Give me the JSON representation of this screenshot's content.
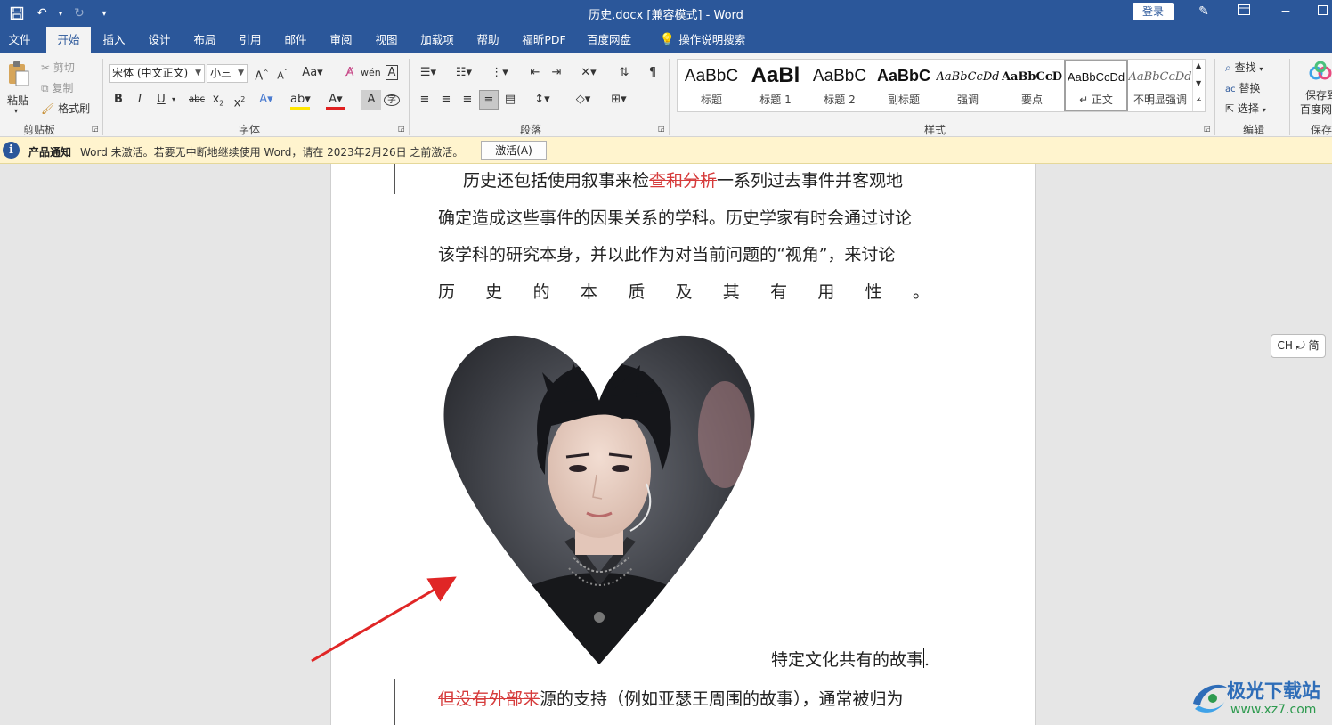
{
  "titlebar": {
    "title": "历史.docx [兼容模式]  -  Word",
    "login": "登录"
  },
  "menu": {
    "tabs": [
      "文件",
      "开始",
      "插入",
      "设计",
      "布局",
      "引用",
      "邮件",
      "审阅",
      "视图",
      "加载项",
      "帮助",
      "福昕PDF",
      "百度网盘"
    ],
    "active": "开始",
    "search": "操作说明搜索"
  },
  "ribbon": {
    "clipboard": {
      "paste": "粘贴",
      "cut": "剪切",
      "copy": "复制",
      "format_painter": "格式刷",
      "label": "剪贴板"
    },
    "font": {
      "font_name": "宋体 (中文正文)",
      "font_size": "小三",
      "label": "字体"
    },
    "paragraph": {
      "label": "段落"
    },
    "styles": {
      "label": "样式",
      "items": [
        {
          "sample": "AaBbC",
          "name": "标题"
        },
        {
          "sample": "AaBl",
          "name": "标题 1"
        },
        {
          "sample": "AaBbC",
          "name": "标题 2"
        },
        {
          "sample": "AaBbC",
          "name": "副标题"
        },
        {
          "sample": "AaBbCcDd",
          "name": "强调"
        },
        {
          "sample": "AaBbCcD",
          "name": "要点"
        },
        {
          "sample": "AaBbCcDd",
          "name": "↵ 正文"
        },
        {
          "sample": "AaBbCcDd",
          "name": "不明显强调"
        }
      ],
      "selected_index": 6
    },
    "editing": {
      "find": "查找",
      "replace": "替换",
      "select": "选择",
      "label": "编辑"
    },
    "save": {
      "line1": "保存到",
      "line2": "百度网",
      "label": "保存"
    }
  },
  "notice": {
    "title": "产品通知",
    "message": "Word 未激活。若要无中断地继续使用 Word，请在 2023年2月26日 之前激活。",
    "button": "激活(A)"
  },
  "document": {
    "para1": {
      "line1_pre": "历史还包括使用叙事来检",
      "line1_deleted": "查和分析",
      "line1_post": "一系列过去事件并客观地",
      "line2": "确定造成这些事件的因果关系的学科。历史学家有时会通过讨论",
      "line3": "该学科的研究本身，并以此作为对当前问题的“视角”，来讨论",
      "line4_chars": [
        "历",
        "史",
        "的",
        "本",
        "质",
        "及",
        "其",
        "有",
        "用",
        "性",
        "。"
      ]
    },
    "caption": "特定文化共有的故事",
    "caption_end": ".",
    "para2": {
      "deleted": "但没有外部来",
      "rest": "源的支持（例如亚瑟王周围的故事），通常被归为"
    }
  },
  "ime": "CH ⤾ 简",
  "watermark": {
    "name": "极光下载站",
    "url": "www.xz7.com"
  }
}
